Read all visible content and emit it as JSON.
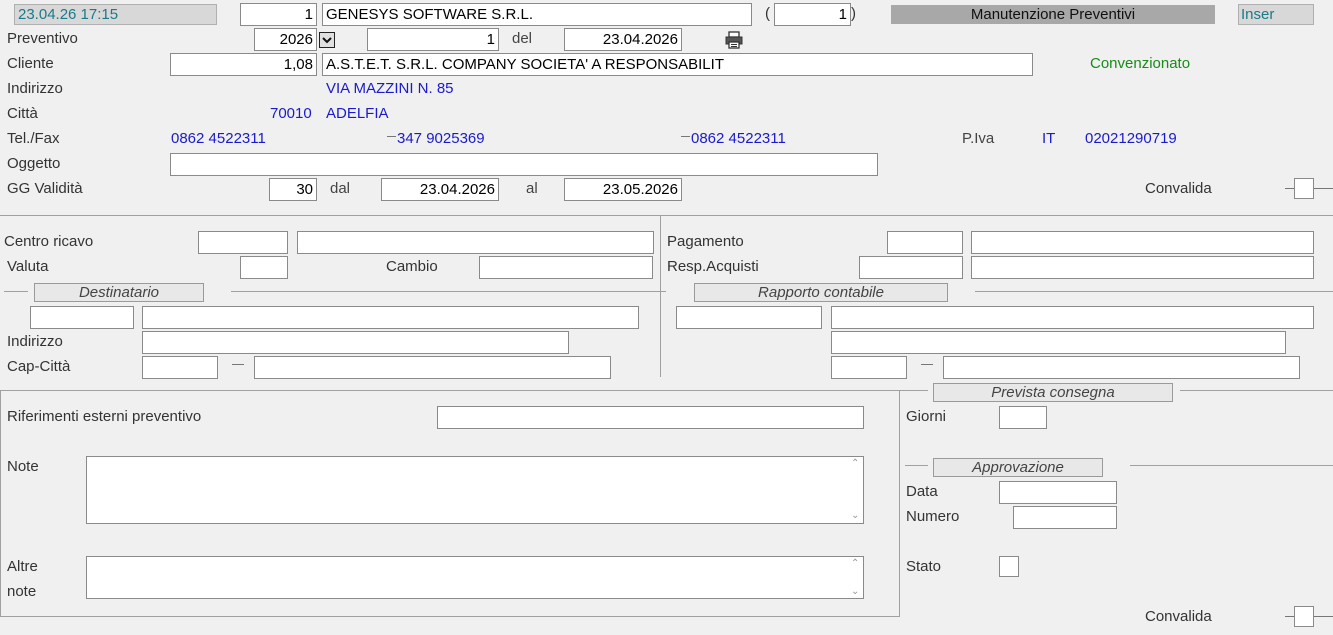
{
  "header": {
    "datetime": "23.04.26 17:15",
    "company_code": "1",
    "company_name": "GENESYS SOFTWARE S.R.L.",
    "paren_open": "(",
    "paren_value": "1",
    "paren_close": ")",
    "window_title": "Manutenzione Preventivi",
    "mode": "Inser"
  },
  "preventivo": {
    "label": "Preventivo",
    "year": "2026",
    "number": "1",
    "del_label": "del",
    "date": "23.04.2026"
  },
  "cliente": {
    "label": "Cliente",
    "code": "1,08",
    "name": "A.S.T.E.T. S.R.L. COMPANY SOCIETA' A RESPONSABILIT",
    "status": "Convenzionato"
  },
  "indirizzo": {
    "label": "Indirizzo",
    "value": "VIA MAZZINI N. 85"
  },
  "citta": {
    "label": "Città",
    "cap": "70010",
    "value": "ADELFIA"
  },
  "telfax": {
    "label": "Tel./Fax",
    "phone1": "0862 4522311",
    "phone2": "347  9025369",
    "phone3": "0862 4522311",
    "piva_label": "P.Iva",
    "piva_country": "IT",
    "piva_number": "02021290719"
  },
  "oggetto": {
    "label": "Oggetto",
    "value": ""
  },
  "validita": {
    "label": "GG Validità",
    "days": "30",
    "dal_label": "dal",
    "from": "23.04.2026",
    "al_label": "al",
    "to": "23.05.2026",
    "convalida_label": "Convalida"
  },
  "left_panel": {
    "centro_ricavo_label": "Centro ricavo",
    "valuta_label": "Valuta",
    "cambio_label": "Cambio",
    "destinatario_title": "Destinatario",
    "indirizzo_label": "Indirizzo",
    "capcitta_label": "Cap-Città"
  },
  "right_panel": {
    "pagamento_label": "Pagamento",
    "resp_acquisti_label": "Resp.Acquisti",
    "rapporto_title": "Rapporto contabile"
  },
  "bottom": {
    "riferimenti_label": "Riferimenti esterni preventivo",
    "note_label": "Note",
    "altre_label": "Altre",
    "note2_label": "note",
    "prevista_title": "Prevista consegna",
    "giorni_label": "Giorni",
    "approvazione_title": "Approvazione",
    "data_label": "Data",
    "numero_label": "Numero",
    "stato_label": "Stato",
    "convalida_label": "Convalida"
  },
  "icons": {
    "dropdown": "dropdown-arrow-icon",
    "print": "printer-icon"
  },
  "colors": {
    "value_blue": "#1a1acc",
    "status_green": "#1a8a1a",
    "header_teal": "#1a7a8a"
  }
}
